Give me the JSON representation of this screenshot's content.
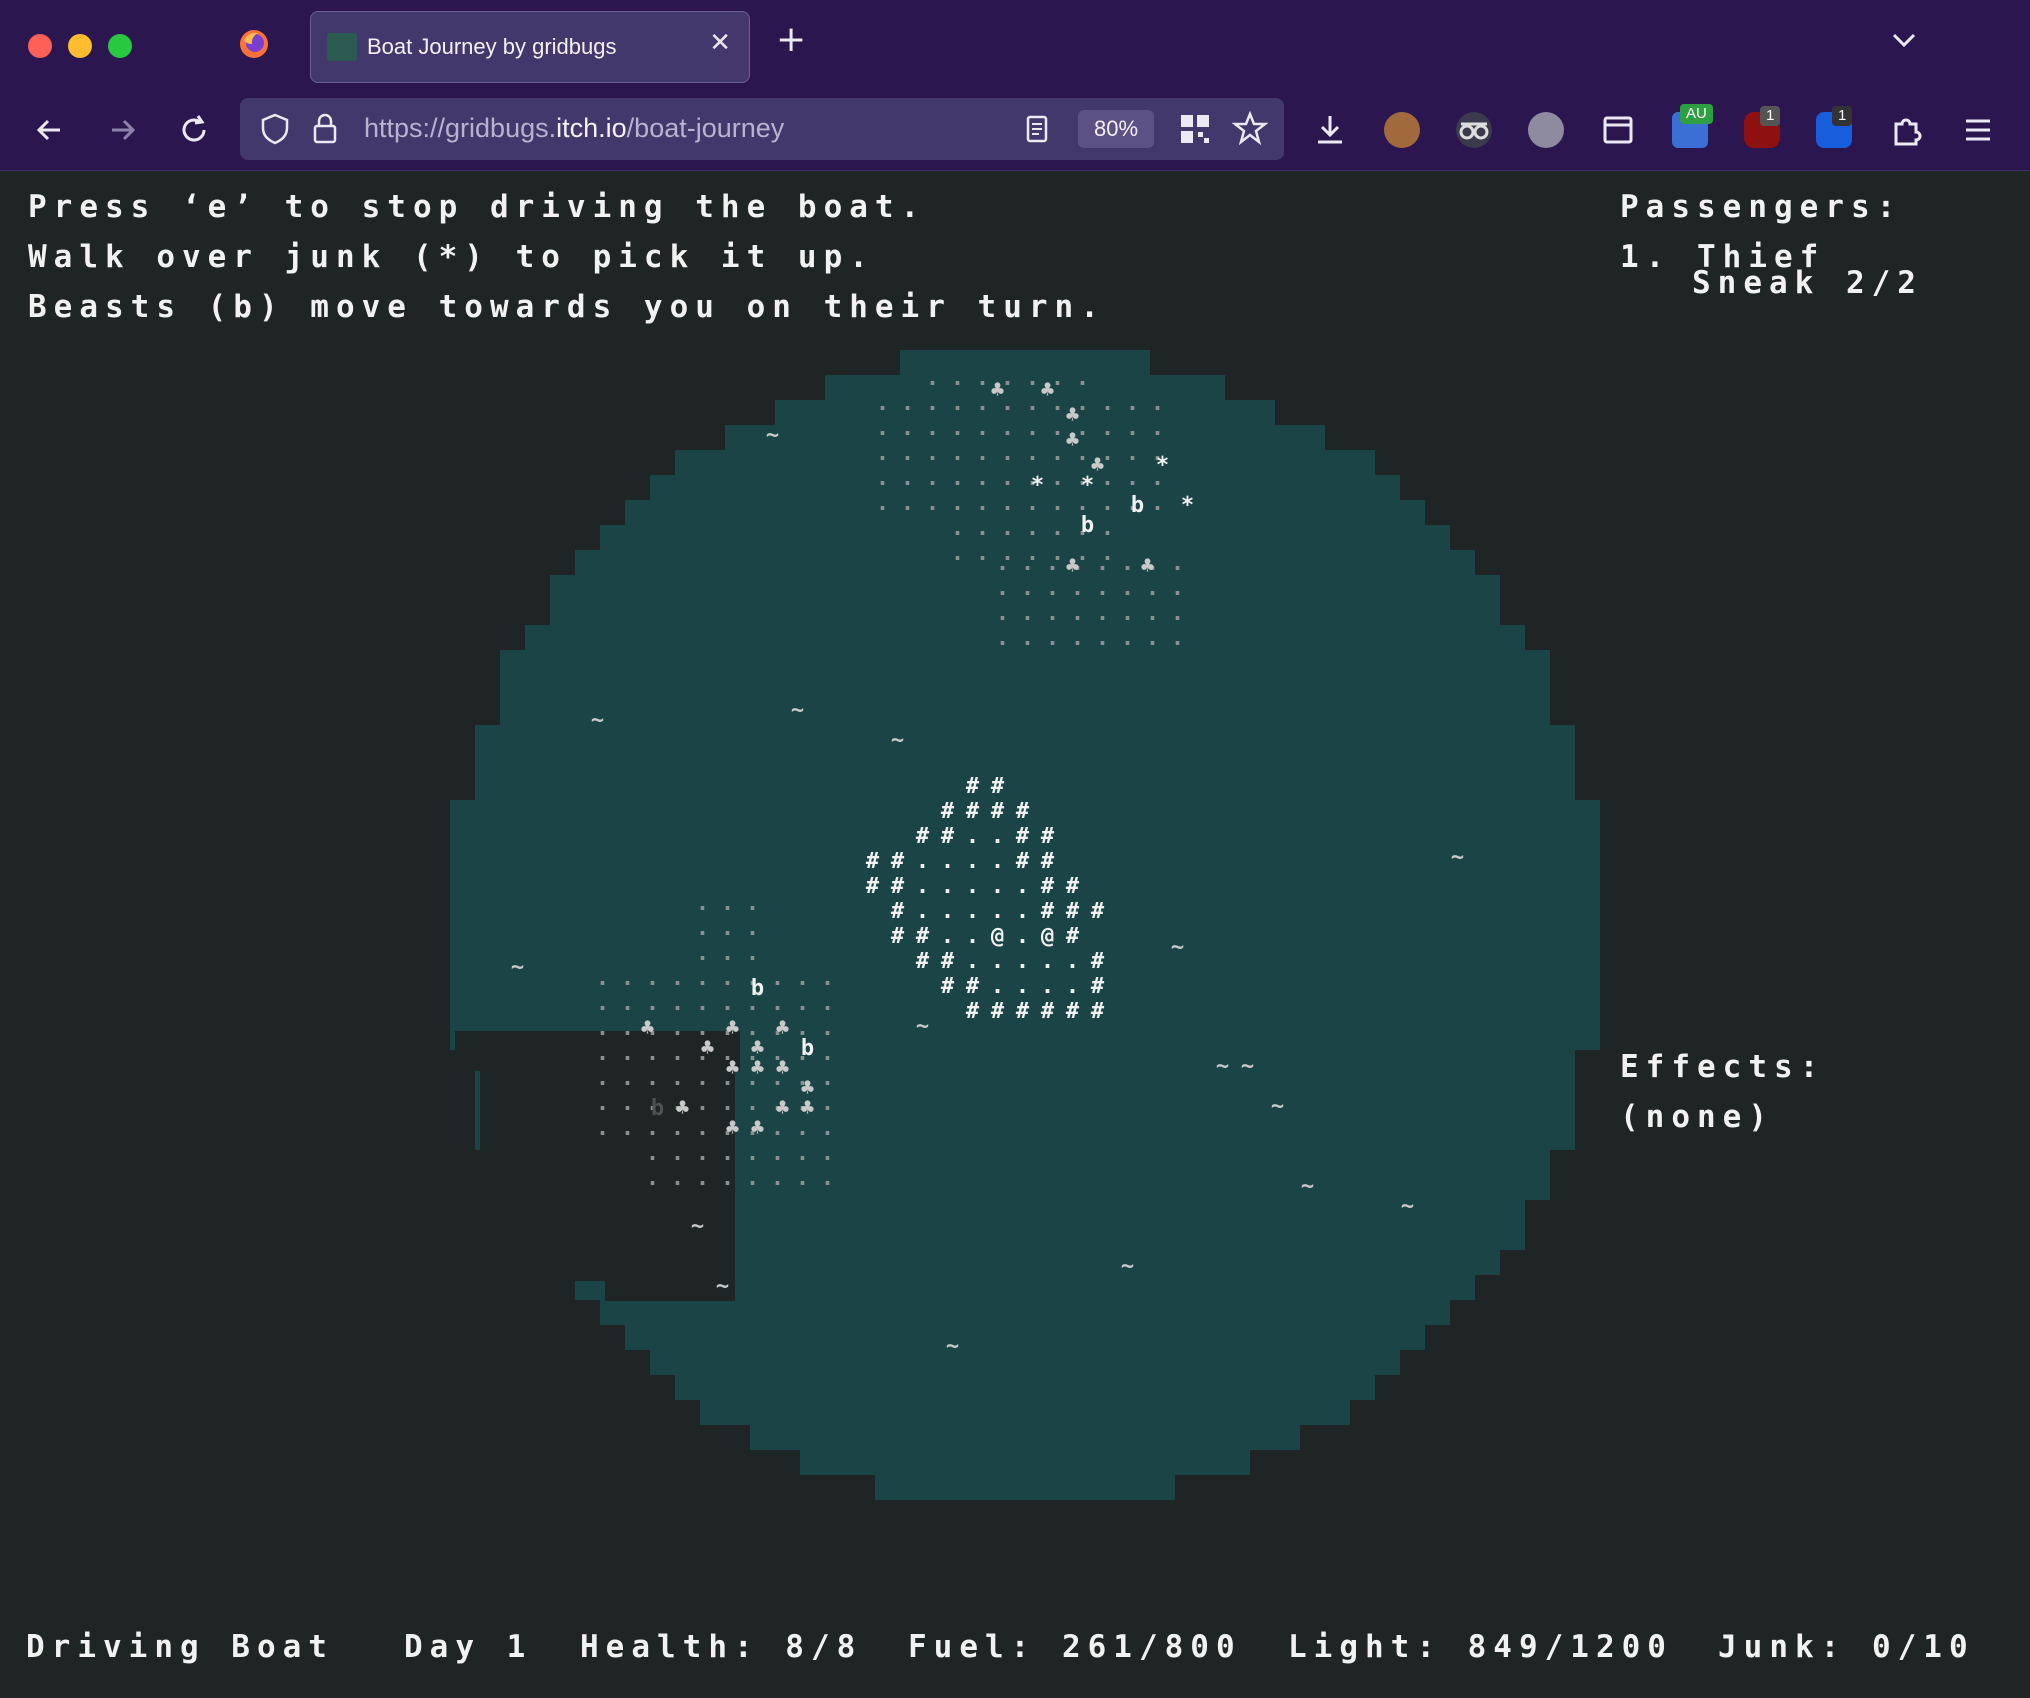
{
  "browser": {
    "tab_title": "Boat Journey by gridbugs",
    "close_glyph": "✕",
    "newtab_glyph": "+",
    "url_prefix": "https://gridbugs.",
    "url_host": "itch.io",
    "url_path": "/boat-journey",
    "zoom": "80%",
    "ext_badges": {
      "au": "AU",
      "ublock": "1",
      "bitwarden": "1"
    }
  },
  "game": {
    "instructions": [
      "Press ‘e’ to stop driving the boat.",
      "Walk over junk (*) to pick it up.",
      "Beasts (b) move towards you on their turn."
    ],
    "passengers_title": "Passengers:",
    "passenger_1_name": "1. Thief",
    "passenger_1_stat": "Sneak 2/2",
    "effects_title": "Effects:",
    "effects_value": "(none)",
    "status": {
      "mode": "Driving Boat",
      "day": "Day 1",
      "health": "Health: 8/8",
      "fuel": "Fuel: 261/800",
      "light": "Light: 849/1200",
      "junk": "Junk: 0/10"
    },
    "colors": {
      "water": "#1b4447",
      "dark_ground": "#1f2424",
      "text": "#f2f2f2",
      "tree": "#c9c9c9",
      "dim": "#8a9090"
    },
    "tiles": {
      "tree": "♣",
      "junk": "*",
      "beast": "b",
      "wall": "#",
      "floor": ".",
      "player": "@",
      "wave": "~"
    }
  }
}
